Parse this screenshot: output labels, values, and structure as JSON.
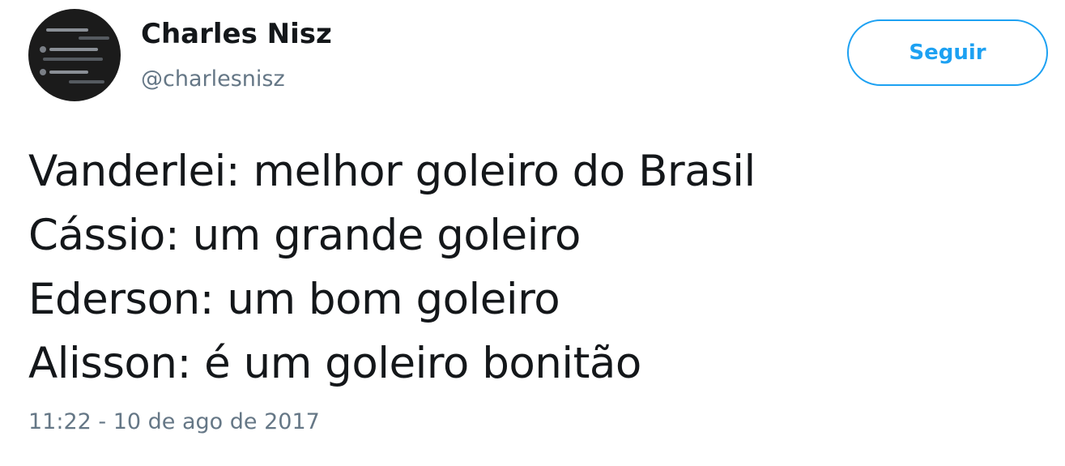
{
  "user": {
    "display_name": "Charles Nisz",
    "handle": "@charlesnisz"
  },
  "follow_button": {
    "label": "Seguir"
  },
  "tweet": {
    "lines": [
      "Vanderlei: melhor goleiro do Brasil",
      "Cássio: um grande goleiro",
      "Ederson: um bom goleiro",
      "Alisson: é um goleiro bonitão"
    ],
    "timestamp": "11:22 - 10 de ago de 2017"
  },
  "colors": {
    "accent": "#1da1f2",
    "text": "#14171a",
    "secondary": "#657786"
  }
}
